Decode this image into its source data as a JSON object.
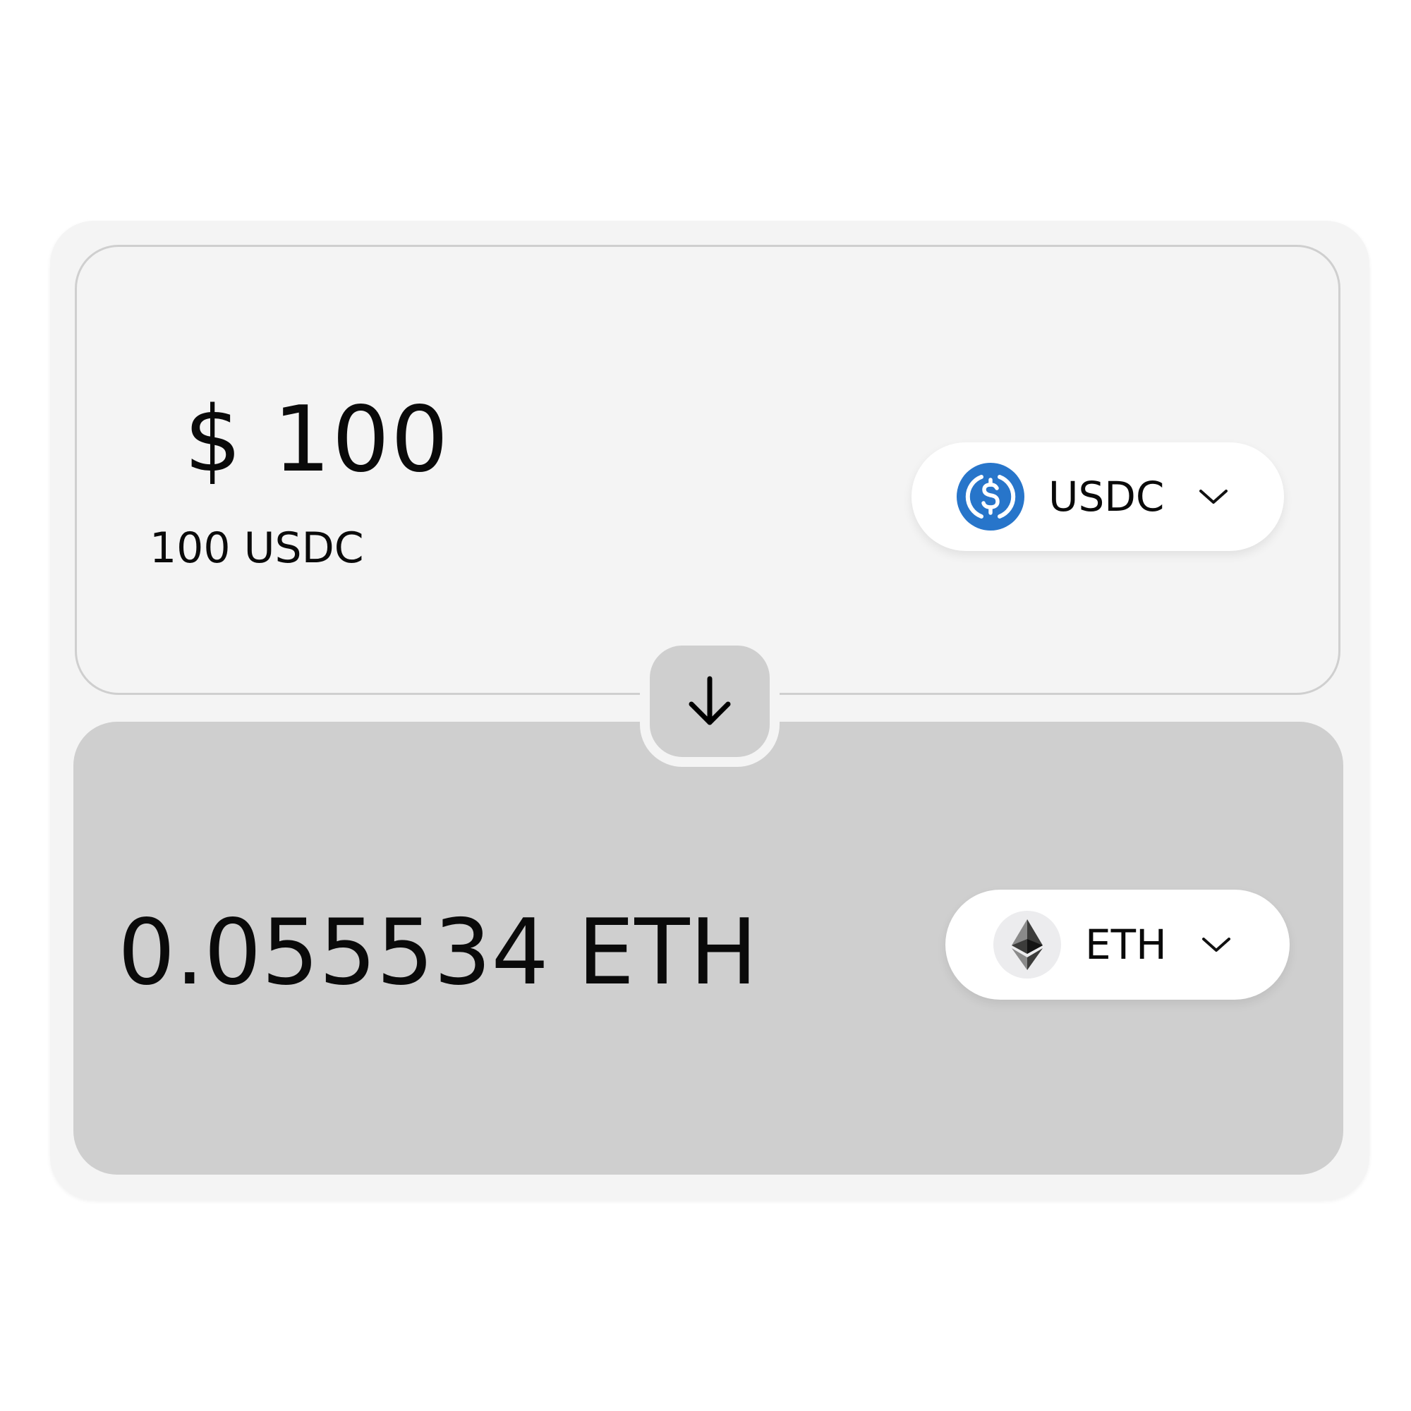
{
  "from": {
    "fiat_amount": "$ 100",
    "token_amount": "100 USDC",
    "token": {
      "symbol": "USDC",
      "icon": "usdc-icon",
      "color": "#2775CA"
    }
  },
  "swap": {
    "icon": "arrow-down-icon"
  },
  "to": {
    "token_amount": "0.055534 ETH",
    "token": {
      "symbol": "ETH",
      "icon": "eth-icon"
    }
  },
  "colors": {
    "card_bg": "#f4f4f4",
    "output_panel_bg": "#cfcfcf",
    "pill_bg": "#ffffff"
  }
}
